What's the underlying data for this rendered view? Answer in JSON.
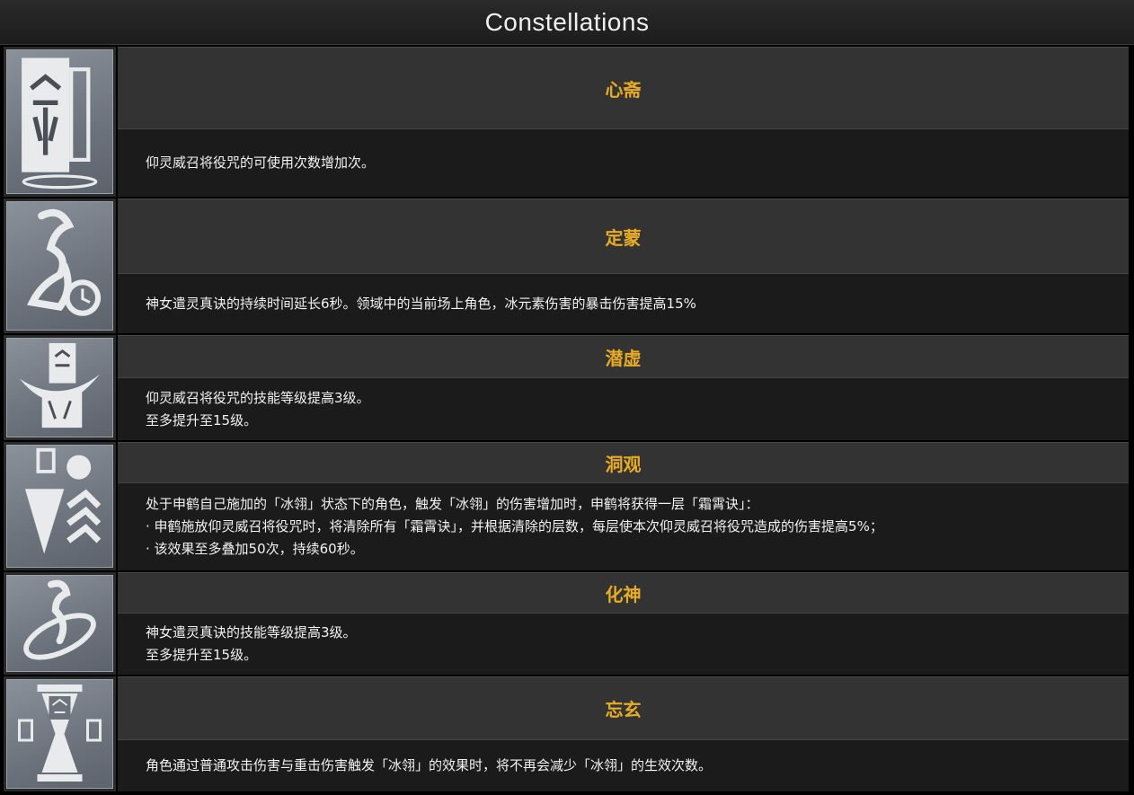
{
  "header": {
    "title": "Constellations"
  },
  "constellations": [
    {
      "name": "心斋",
      "icon": "talisman-scroll-icon",
      "description": [
        "仰灵威召将役咒的可使用次数增加次。"
      ]
    },
    {
      "name": "定蒙",
      "icon": "spirit-timer-icon",
      "description": [
        "神女遣灵真诀的持续时间延长6秒。领域中的当前场上角色，冰元素伤害的暴击伤害提高15%"
      ]
    },
    {
      "name": "潜虚",
      "icon": "talisman-swirl-icon",
      "description": [
        "仰灵威召将役咒的技能等级提高3级。",
        "至多提升至15级。"
      ]
    },
    {
      "name": "洞观",
      "icon": "frost-stack-icon",
      "description": [
        "处于申鹤自己施加的「冰翎」状态下的角色，触发「冰翎」的伤害增加时，申鹤将获得一层「霜霄诀」：",
        "· 申鹤施放仰灵威召将役咒时，将清除所有「霜霄诀」，并根据清除的层数，每层使本次仰灵威召将役咒造成的伤害提高5%；",
        "· 该效果至多叠加50次，持续60秒。"
      ]
    },
    {
      "name": "化神",
      "icon": "spirit-swirl-icon",
      "description": [
        "神女遣灵真诀的技能等级提高3级。",
        "至多提升至15级。"
      ]
    },
    {
      "name": "忘玄",
      "icon": "hourglass-talisman-icon",
      "description": [
        "角色通过普通攻击伤害与重击伤害触发「冰翎」的效果时，将不再会减少「冰翎」的生效次数。"
      ]
    }
  ]
}
